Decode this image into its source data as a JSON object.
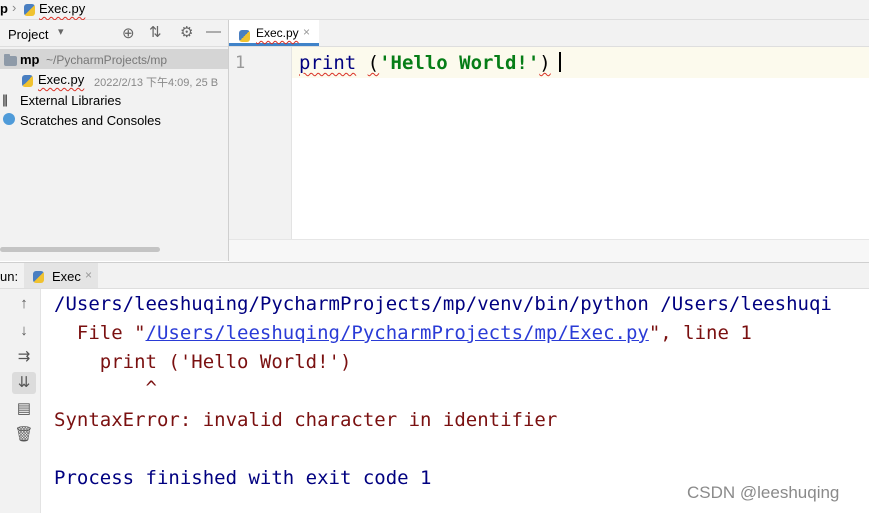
{
  "breadcrumb": {
    "root": "p",
    "file": "Exec.py"
  },
  "project": {
    "header_label": "Project",
    "tree": [
      {
        "name": "mp",
        "path": "~/PycharmProjects/mp"
      },
      {
        "name": "Exec.py",
        "meta": "2022/2/13 下午4:09, 25 B"
      },
      {
        "name": "External Libraries"
      },
      {
        "name": "Scratches and Consoles"
      }
    ]
  },
  "editor": {
    "tab_label": "Exec.py",
    "line_number": "1",
    "code": {
      "func": "print",
      "space": " ",
      "open_paren": "(",
      "string": "'Hello World!'",
      "close_paren": ")"
    }
  },
  "run": {
    "label": "un:",
    "tab_label": "Exec",
    "console": {
      "line1": "/Users/leeshuqing/PycharmProjects/mp/venv/bin/python /Users/leeshuqi",
      "line2_prefix": "  File \"",
      "line2_link": "/Users/leeshuqing/PycharmProjects/mp/Exec.py",
      "line2_suffix": "\", line 1",
      "line3": "    print ('Hello World!')",
      "line4": "        ^",
      "line5": "SyntaxError: invalid character in identifier",
      "line6": "Process finished with exit code 1"
    }
  },
  "watermark": "CSDN @leeshuqing",
  "colors": {
    "keyword_blue": "#000080",
    "string_green": "#067d17",
    "error_red": "#7a1010",
    "link_blue": "#2a3bd6",
    "squiggle_red": "#d93025"
  }
}
